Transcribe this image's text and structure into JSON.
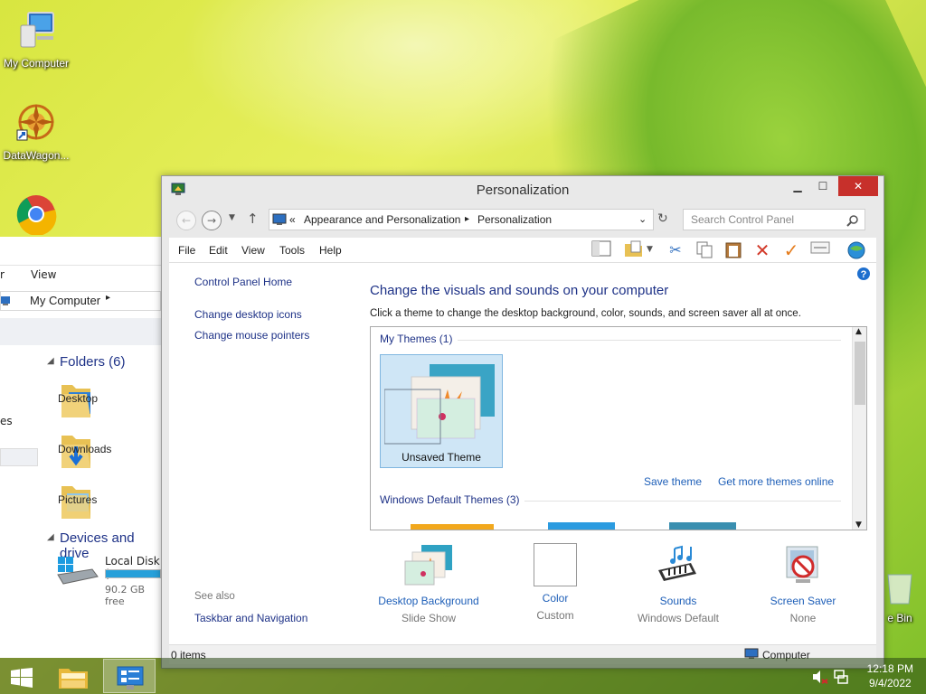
{
  "desktop": {
    "icons": [
      {
        "label": "My Computer"
      },
      {
        "label": "DataWagon..."
      },
      {
        "label": ""
      }
    ],
    "recycle_label": "e Bin"
  },
  "explorer": {
    "ribbon_r": "r",
    "ribbon_view": "View",
    "address": "My Computer",
    "side_fragment": "es",
    "folders_header": "Folders (6)",
    "folders": [
      "Desktop",
      "Downloads",
      "Pictures"
    ],
    "devices_header": "Devices and drive",
    "disk_name": "Local Disk (",
    "disk_free": "90.2 GB free"
  },
  "window": {
    "title": "Personalization",
    "address": {
      "prefix": "«",
      "crumb1": "Appearance and Personalization",
      "crumb2": "Personalization"
    },
    "search_placeholder": "Search Control Panel",
    "menu": [
      "File",
      "Edit",
      "View",
      "Tools",
      "Help"
    ],
    "left_links": {
      "home": "Control Panel Home",
      "desktop_icons": "Change desktop icons",
      "mouse_pointers": "Change mouse pointers",
      "see_also": "See also",
      "taskbar_nav": "Taskbar and Navigation"
    },
    "heading": "Change the visuals and sounds on your computer",
    "subtext": "Click a theme to change the desktop background, color, sounds, and screen saver all at once.",
    "themes": {
      "my_themes": "My Themes (1)",
      "tile_label": "Unsaved Theme",
      "save_theme": "Save theme",
      "get_more": "Get more themes online",
      "default_themes": "Windows Default Themes (3)"
    },
    "bottom": [
      {
        "title": "Desktop Background",
        "sub": "Slide Show"
      },
      {
        "title": "Color",
        "sub": "Custom"
      },
      {
        "title": "Sounds",
        "sub": "Windows Default"
      },
      {
        "title": "Screen Saver",
        "sub": "None"
      }
    ],
    "status": {
      "items": "0 items",
      "computer": "Computer"
    }
  },
  "taskbar": {
    "time": "12:18 PM",
    "date": "9/4/2022"
  },
  "colors": {
    "close": "#c7302b",
    "link": "#1e3287",
    "accent_link": "#1e5fb8"
  }
}
